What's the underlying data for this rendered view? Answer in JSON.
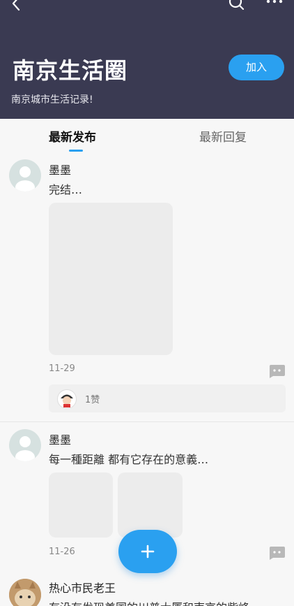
{
  "header": {
    "title": "南京生活圈",
    "subtitle": "南京城市生活记录!",
    "join_label": "加入"
  },
  "tabs": [
    {
      "label": "最新发布",
      "active": true
    },
    {
      "label": "最新回复",
      "active": false
    }
  ],
  "posts": [
    {
      "author": "墨墨",
      "content": "完结…",
      "date": "11-29",
      "likes": "1赞",
      "images": 1
    },
    {
      "author": "墨墨",
      "content": "每一種距離 都有它存在的意義…",
      "date": "11-26",
      "images": 2
    },
    {
      "author": "热心市民老王",
      "content": "有没有发现美国的川普大厦和南京的紫峰"
    }
  ],
  "colors": {
    "header_bg": "#3a3a52",
    "accent": "#2aa0f0"
  },
  "icons": [
    "back-arrow-icon",
    "search-icon",
    "more-icon",
    "comment-icon",
    "plus-icon"
  ]
}
